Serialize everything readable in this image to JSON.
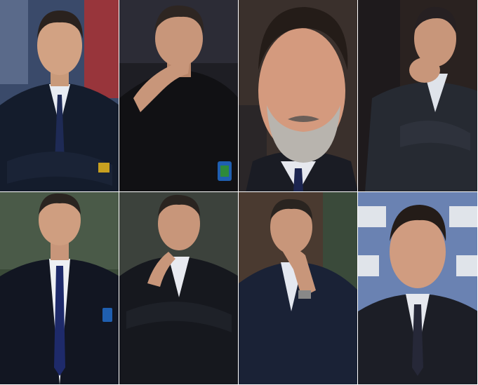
{
  "collage": {
    "photos": [
      {
        "id": "photo-1",
        "desc": "man-in-navy-suit-arms-crossed",
        "bg": "#2a3a5a"
      },
      {
        "id": "photo-2",
        "desc": "man-hand-near-mouth-dark-jacket",
        "bg": "#1c1c22"
      },
      {
        "id": "photo-3",
        "desc": "closeup-man-grey-beard",
        "bg": "#3a2e2a"
      },
      {
        "id": "photo-4",
        "desc": "man-hands-clasped-near-face",
        "bg": "#2a2420"
      },
      {
        "id": "photo-5",
        "desc": "man-in-suit-blue-tie-stadium",
        "bg": "#2d3a2c"
      },
      {
        "id": "photo-6",
        "desc": "man-arms-crossed-hand-at-chin",
        "bg": "#3a3f3a"
      },
      {
        "id": "photo-7",
        "desc": "man-thinking-hand-on-chin",
        "bg": "#4a3a30"
      },
      {
        "id": "photo-8",
        "desc": "man-press-conference-backdrop",
        "bg": "#5a6f9a"
      }
    ]
  }
}
